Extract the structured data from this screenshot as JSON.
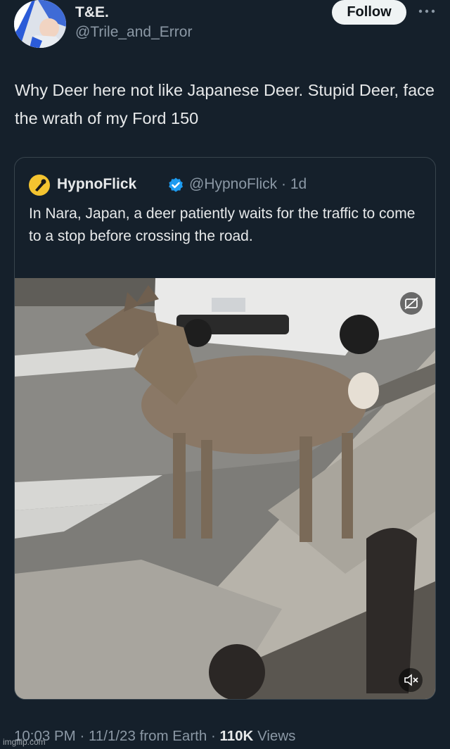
{
  "author": {
    "name": "T&E.",
    "handle": "@Trile_and_Error"
  },
  "actions": {
    "follow_label": "Follow",
    "more_icon": "more-horizontal-icon"
  },
  "tweet": {
    "text": "Why Deer here not like Japanese Deer. Stupid Deer, face the wrath of my Ford 150"
  },
  "quote": {
    "name": "HypnoFlick",
    "handle": "@HypnoFlick",
    "time": "1d",
    "text": "In Nara, Japan, a deer patiently waits for the traffic to come to a stop before crossing the road.",
    "verified_color": "#1d9bf0"
  },
  "footer": {
    "time": "10:03 PM",
    "date": "11/1/23",
    "source": "from Earth",
    "views_count": "110K",
    "views_label": "Views"
  },
  "watermark": "imgflip.com",
  "colors": {
    "background": "#15202b",
    "text": "#e7e9ea",
    "secondary": "#8b98a5",
    "border": "#38444d"
  }
}
